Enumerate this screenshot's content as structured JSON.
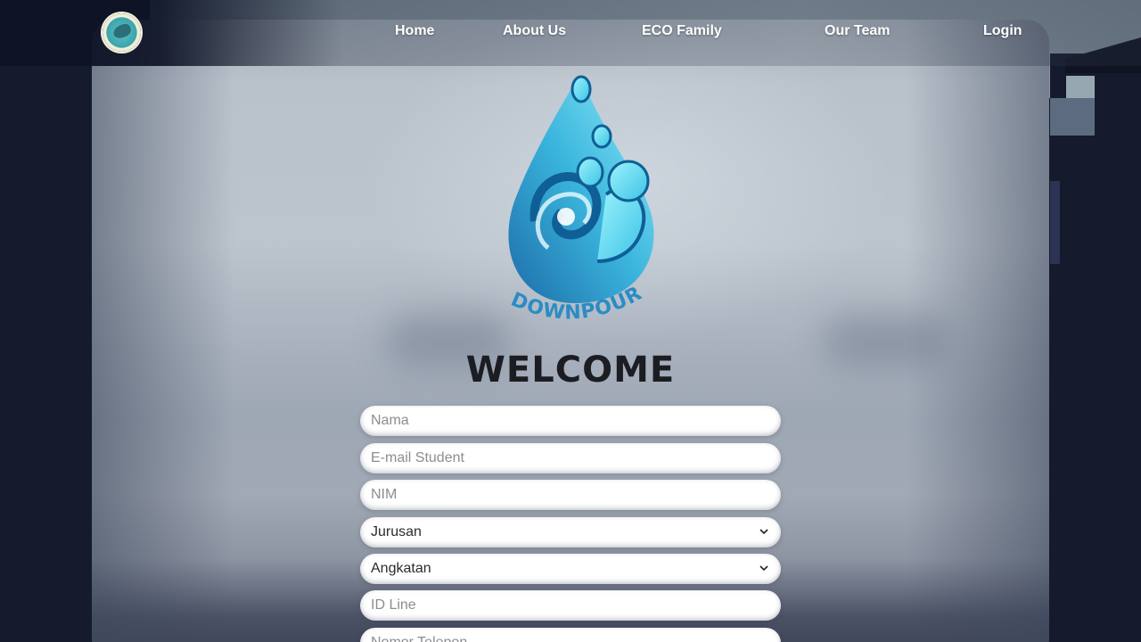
{
  "nav": {
    "home": "Home",
    "about": "About Us",
    "family": "ECO Family",
    "team": "Our Team",
    "login": "Login"
  },
  "brand": {
    "logo_icon": "eco-club-badge-icon",
    "event_logo_icon": "water-drop-logo-icon",
    "event_name": "DOWNPOUR"
  },
  "page": {
    "title": "WELCOME"
  },
  "form": {
    "name_placeholder": "Nama",
    "email_placeholder": "E-mail Student",
    "nim_placeholder": "NIM",
    "jurusan_selected": "Jurusan",
    "angkatan_selected": "Angkatan",
    "line_placeholder": "ID Line",
    "phone_placeholder": "Nomor Telepon"
  },
  "colors": {
    "navbar_text": "#ffffff",
    "title": "#1c1d22",
    "drop_light": "#7fe6f5",
    "drop_dark": "#1a7ab8",
    "background": "#151a2d"
  }
}
